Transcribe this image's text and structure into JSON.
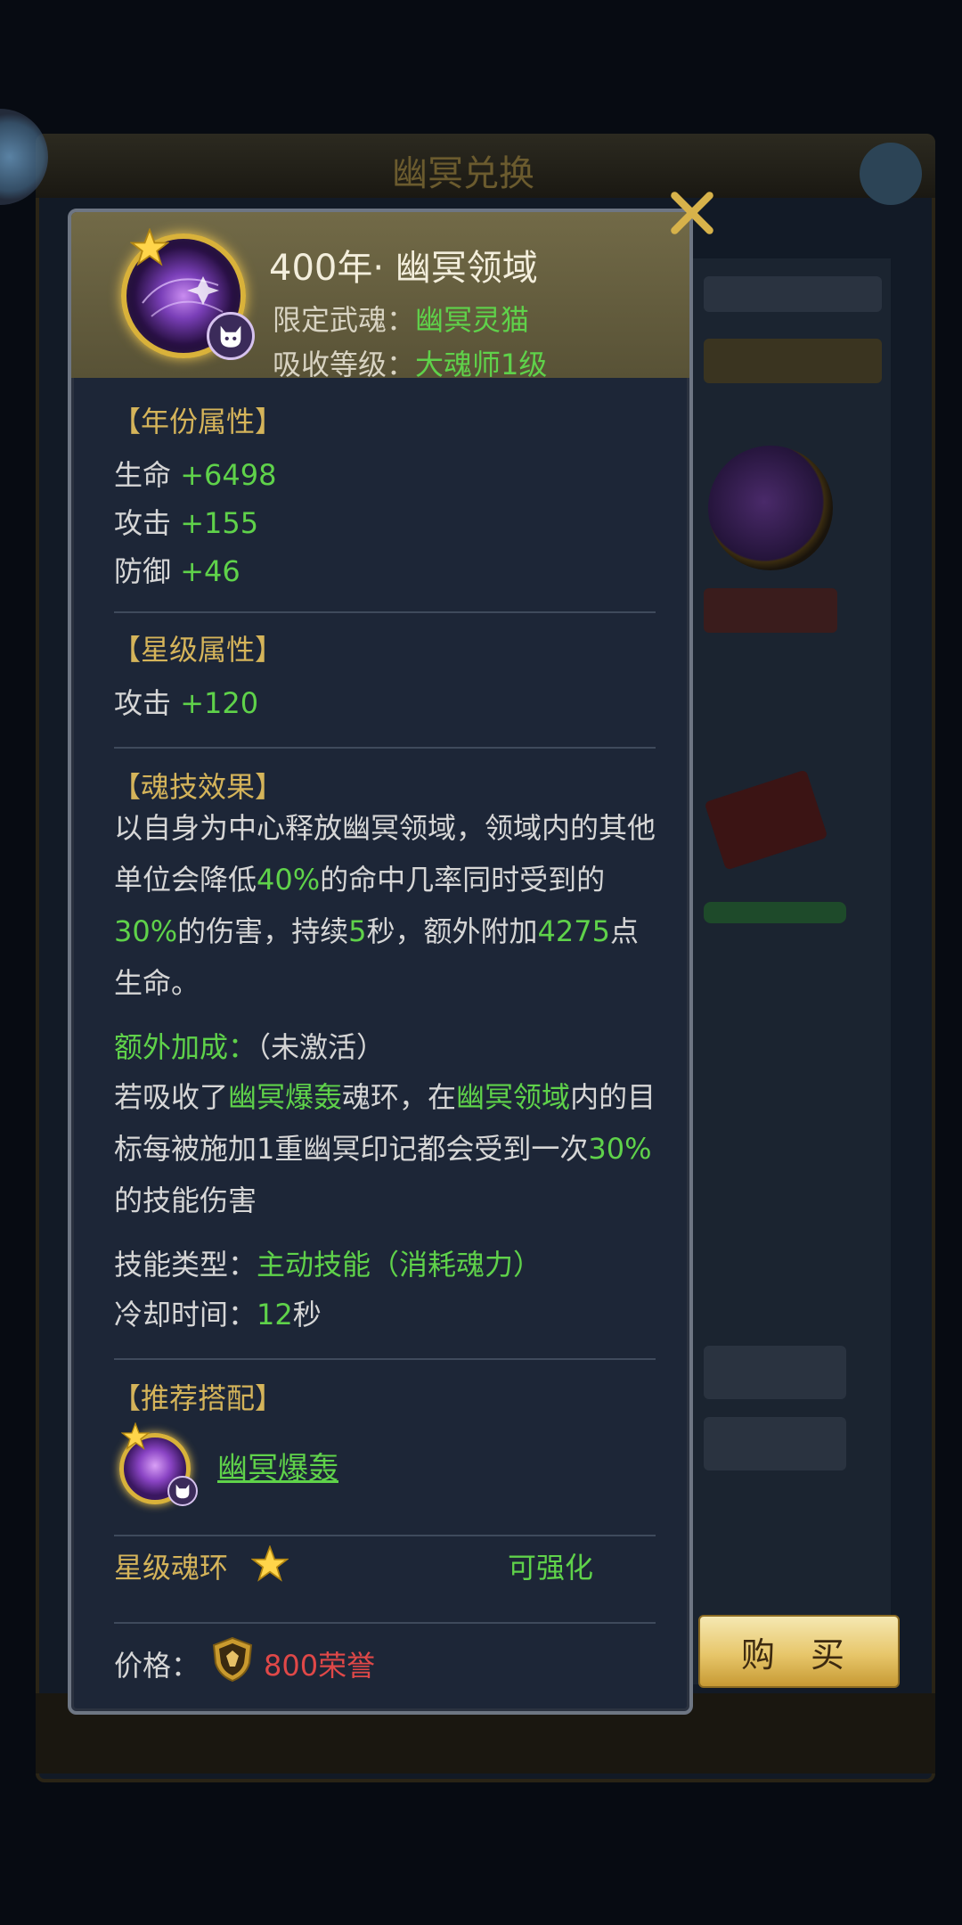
{
  "skill": {
    "name": "400年·  幽冥领域",
    "restriction_label": "限定武魂：",
    "restriction_value": "幽冥灵猫",
    "level_label": "吸收等级：",
    "level_value": "大魂师1级"
  },
  "year_attributes": {
    "title": "【年份属性】",
    "stats": [
      {
        "label": "生命",
        "value": "+6498"
      },
      {
        "label": "攻击",
        "value": "+155"
      },
      {
        "label": "防御",
        "value": "+46"
      }
    ]
  },
  "star_attributes": {
    "title": "【星级属性】",
    "stats": [
      {
        "label": "攻击",
        "value": "+120"
      }
    ]
  },
  "effect": {
    "title": "【魂技效果】",
    "seg1": "以自身为中心释放幽冥领域，领域内的其他单位会降低",
    "pct1": "40%",
    "seg2": "的命中几率同时受到的",
    "pct2": "30%",
    "seg3": "的伤害，持续",
    "duration": "5",
    "seg4": "秒，额外附加",
    "hp": "4275",
    "seg5": "点生命。",
    "bonus_label": "额外加成：",
    "bonus_status": "（未激活）",
    "b1": "若吸收了",
    "b_link1": "幽冥爆轰",
    "b2": "魂环，在",
    "b_link2": "幽冥领域",
    "b3": "内的目标每被施加1重幽冥印记都会受到一次",
    "b_pct": "30%",
    "b4": "的技能伤害",
    "type_label": "技能类型：",
    "type_value": "主动技能（消耗魂力）",
    "cd_label": "冷却时间：",
    "cd_value": "12",
    "cd_unit": "秒"
  },
  "recommend": {
    "title": "【推荐搭配】",
    "item": "幽冥爆轰"
  },
  "star_ring": {
    "label": "星级魂环",
    "status": "可强化"
  },
  "price": {
    "label": "价格：",
    "value": "800荣誉"
  },
  "buy_button": "购 买",
  "background": {
    "title": "幽冥兑换"
  },
  "colors": {
    "green": "#5fd24a",
    "gold": "#d5b45a",
    "red": "#e04848"
  }
}
